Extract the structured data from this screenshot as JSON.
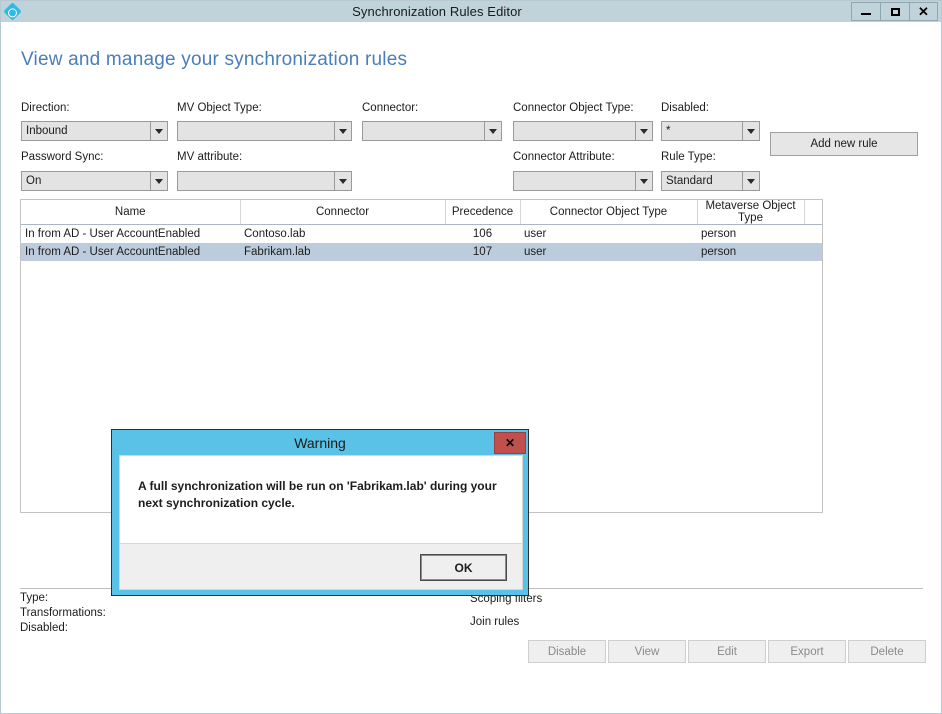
{
  "window": {
    "title": "Synchronization Rules Editor",
    "icon": "diamond-sync-icon",
    "controls": {
      "minimize": "–",
      "maximize": "❑",
      "close": "✕"
    }
  },
  "page": {
    "heading": "View and manage your synchronization rules"
  },
  "filters": [
    {
      "label": "Direction:",
      "value": "Inbound",
      "name": "direction"
    },
    {
      "label": "MV Object Type:",
      "value": "",
      "name": "mv-object-type"
    },
    {
      "label": "Connector:",
      "value": "",
      "name": "connector"
    },
    {
      "label": "Connector Object Type:",
      "value": "",
      "name": "connector-object-type"
    },
    {
      "label": "Disabled:",
      "value": "*",
      "name": "disabled"
    },
    {
      "label": "Password Sync:",
      "value": "On",
      "name": "password-sync"
    },
    {
      "label": "MV attribute:",
      "value": "",
      "name": "mv-attribute"
    },
    {
      "label": "Connector Attribute:",
      "value": "",
      "name": "connector-attribute"
    },
    {
      "label": "Rule Type:",
      "value": "Standard",
      "name": "rule-type"
    }
  ],
  "toolbar": {
    "add_new_rule": "Add new rule"
  },
  "grid": {
    "columns": [
      "Name",
      "Connector",
      "Precedence",
      "Connector Object Type",
      "Metaverse Object Type",
      ""
    ],
    "rows": [
      {
        "name": "In from AD - User AccountEnabled",
        "connector": "Contoso.lab",
        "precedence": "106",
        "connector_object_type": "user",
        "metaverse_object_type": "person",
        "selected": false
      },
      {
        "name": "In from AD - User AccountEnabled",
        "connector": "Fabrikam.lab",
        "precedence": "107",
        "connector_object_type": "user",
        "metaverse_object_type": "person",
        "selected": true
      }
    ]
  },
  "details": {
    "left": [
      {
        "label": "Type:"
      },
      {
        "label": "Transformations:"
      },
      {
        "label": "Disabled:"
      }
    ],
    "right": [
      {
        "label": "Scoping filters"
      },
      {
        "label": "Join rules"
      }
    ]
  },
  "actions": [
    {
      "label": "Disable",
      "name": "disable"
    },
    {
      "label": "View",
      "name": "view"
    },
    {
      "label": "Edit",
      "name": "edit"
    },
    {
      "label": "Export",
      "name": "export"
    },
    {
      "label": "Delete",
      "name": "delete"
    }
  ],
  "dialog": {
    "title": "Warning",
    "close_glyph": "✕",
    "message": "A full synchronization will be run on 'Fabrikam.lab' during your next synchronization cycle.",
    "ok_label": "OK"
  },
  "colors": {
    "titlebar": "#c0d3db",
    "heading": "#4a7ebb",
    "dialog_header": "#5bc2e7",
    "dialog_close": "#c0504d",
    "row_selected": "#bcccdc"
  }
}
